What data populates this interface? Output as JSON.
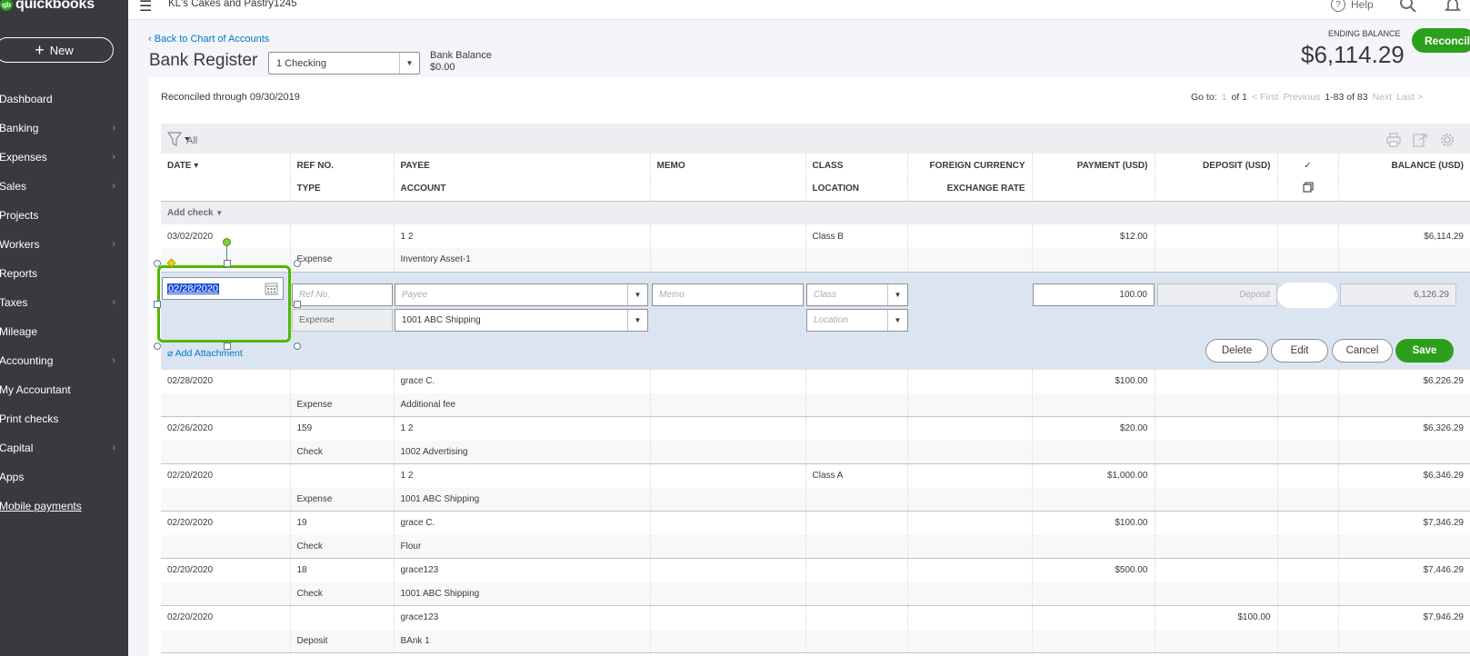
{
  "app": {
    "logo_mark": "qb",
    "logo_text": "quickbooks",
    "company": "KL's Cakes and Pastry1245",
    "help": "Help"
  },
  "sidebar": {
    "new_label": "New",
    "items": [
      {
        "label": "Dashboard",
        "chevron": false
      },
      {
        "label": "Banking",
        "chevron": true
      },
      {
        "label": "Expenses",
        "chevron": true
      },
      {
        "label": "Sales",
        "chevron": true
      },
      {
        "label": "Projects",
        "chevron": false
      },
      {
        "label": "Workers",
        "chevron": true
      },
      {
        "label": "Reports",
        "chevron": false
      },
      {
        "label": "Taxes",
        "chevron": true
      },
      {
        "label": "Mileage",
        "chevron": false
      },
      {
        "label": "Accounting",
        "chevron": true
      },
      {
        "label": "My Accountant",
        "chevron": false
      },
      {
        "label": "Print checks",
        "chevron": false
      },
      {
        "label": "Capital",
        "chevron": true
      },
      {
        "label": "Apps",
        "chevron": false
      },
      {
        "label": "Mobile payments",
        "chevron": false,
        "link": true
      }
    ]
  },
  "header": {
    "back_link": "Back to Chart of Accounts",
    "title": "Bank Register",
    "account": "1 Checking",
    "bank_balance_label": "Bank Balance",
    "bank_balance_value": "$0.00",
    "ending_balance_label": "ENDING BALANCE",
    "ending_balance_value": "$6,114.29",
    "reconcile_label": "Reconcile"
  },
  "toolbar": {
    "reconciled_through": "Reconciled through 09/30/2019",
    "goto_label": "Go to:",
    "page": "1",
    "of_pages": "of 1",
    "first": "< First",
    "previous": "Previous",
    "range": "1-83 of 83",
    "next": "Next",
    "last": "Last >",
    "filter_label": "All"
  },
  "columns": {
    "date": "DATE ▾",
    "ref": "REF NO.",
    "type": "TYPE",
    "payee": "PAYEE",
    "account": "ACCOUNT",
    "memo": "MEMO",
    "class": "CLASS",
    "location": "LOCATION",
    "fx": "FOREIGN CURRENCY",
    "rate": "EXCHANGE RATE",
    "payment": "PAYMENT (USD)",
    "deposit": "DEPOSIT (USD)",
    "check": "✓",
    "balance": "BALANCE (USD)"
  },
  "add_check": "Add check",
  "edit_row": {
    "date": "02/28/2020",
    "ref_placeholder": "Ref No.",
    "payee_placeholder": "Payee",
    "memo_placeholder": "Memo",
    "class_placeholder": "Class",
    "payment": "100.00",
    "deposit_placeholder": "Deposit",
    "balance": "6,126.29",
    "type": "Expense",
    "account": "1001 ABC Shipping",
    "location_placeholder": "Location",
    "attachment": "Add Attachment",
    "delete": "Delete",
    "edit": "Edit",
    "cancel": "Cancel",
    "save": "Save"
  },
  "rows_before": [
    {
      "date": "03/02/2020",
      "ref": "",
      "type": "Expense",
      "payee": "1 2",
      "account": "Inventory Asset-1",
      "class": "Class B",
      "payment": "$12.00",
      "deposit": "",
      "balance": "$6,114.29"
    }
  ],
  "rows_after": [
    {
      "date": "02/28/2020",
      "ref": "",
      "type": "Expense",
      "payee": "grace C.",
      "account": "Additional fee",
      "class": "",
      "payment": "$100.00",
      "deposit": "",
      "balance": "$6,226.29"
    },
    {
      "date": "02/26/2020",
      "ref": "159",
      "type": "Check",
      "payee": "1 2",
      "account": "1002 Advertising",
      "class": "",
      "payment": "$20.00",
      "deposit": "",
      "balance": "$6,326.29"
    },
    {
      "date": "02/20/2020",
      "ref": "",
      "type": "Expense",
      "payee": "1 2",
      "account": "1001 ABC Shipping",
      "class": "Class A",
      "payment": "$1,000.00",
      "deposit": "",
      "balance": "$6,346.29"
    },
    {
      "date": "02/20/2020",
      "ref": "19",
      "type": "Check",
      "payee": "grace C.",
      "account": "Flour",
      "class": "",
      "payment": "$100.00",
      "deposit": "",
      "balance": "$7,346.29"
    },
    {
      "date": "02/20/2020",
      "ref": "18",
      "type": "Check",
      "payee": "grace123",
      "account": "1001 ABC Shipping",
      "class": "",
      "payment": "$500.00",
      "deposit": "",
      "balance": "$7,446.29"
    },
    {
      "date": "02/20/2020",
      "ref": "",
      "type": "Deposit",
      "payee": "grace123",
      "account": "BAnk 1",
      "class": "",
      "payment": "",
      "deposit": "$100.00",
      "balance": "$7,946.29"
    }
  ]
}
